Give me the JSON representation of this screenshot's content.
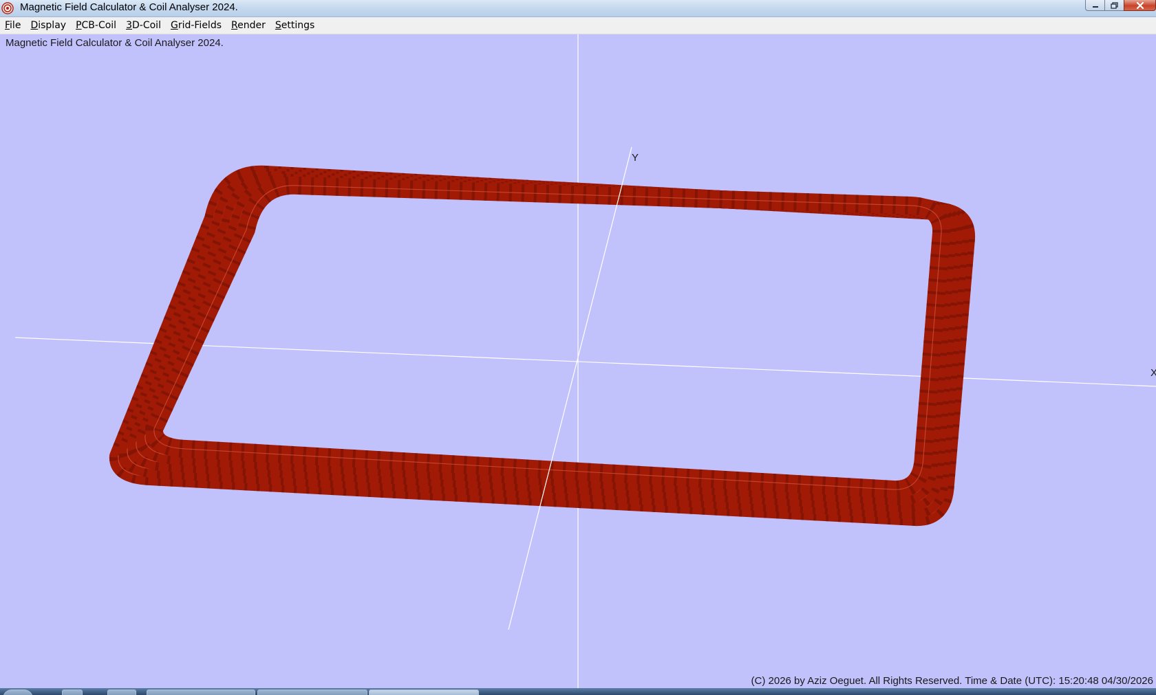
{
  "window": {
    "title": "Magnetic Field Calculator & Coil Analyser 2024.",
    "icon": "app-coil-icon",
    "controls": [
      "minimize-icon",
      "maximize-icon",
      "close-icon"
    ]
  },
  "menu": {
    "items": [
      {
        "label": "File"
      },
      {
        "label": "Display"
      },
      {
        "label": "PCB-Coil"
      },
      {
        "label": "3D-Coil"
      },
      {
        "label": "Grid-Fields"
      },
      {
        "label": "Render"
      },
      {
        "label": "Settings"
      }
    ]
  },
  "viewport": {
    "caption": "Magnetic Field Calculator & Coil Analyser 2024.",
    "axis_labels": {
      "y": "Y",
      "x": "X"
    },
    "background_color": "#c1c1fc",
    "coil_color": "#a11a06",
    "coil_turns": 5,
    "footer": "(C) 2026  by Aziz Oeguet. All Rights Reserved.  Time & Date (UTC): 15:20:48  04/30/2026"
  },
  "taskbar": {
    "icons": [
      "start-orb-icon",
      "desktop-icon",
      "folder-icon",
      "explorer-icon",
      "taskbar-window",
      "taskbar-window",
      "app-coil-icon"
    ]
  }
}
